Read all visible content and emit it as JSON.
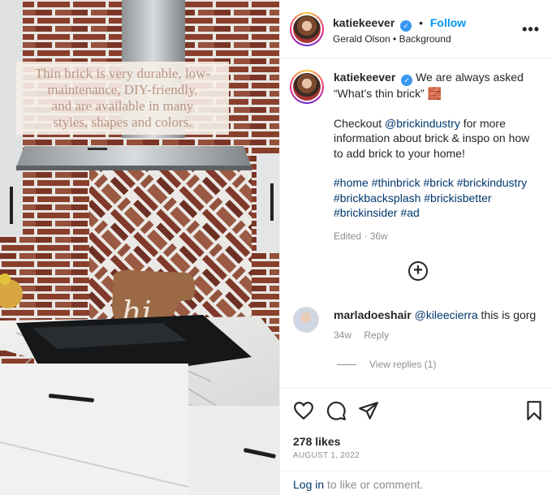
{
  "photo": {
    "caption": "Thin brick is very durable, low-\nmaintenance, DIY-friendly,\nand are available in many\nstyles, shapes and colors.",
    "sign_text": "hi"
  },
  "header": {
    "username": "katiekeever",
    "separator": "•",
    "follow_label": "Follow",
    "subline": "Gerald Olson • Background",
    "more_label": "•••"
  },
  "post": {
    "username": "katiekeever",
    "line1": "We are always asked “What’s thin brick”",
    "emoji": "🧱",
    "para2_pre": "Checkout ",
    "para2_link": "@brickindustry",
    "para2_post": " for more information about brick & inspo on how to add brick to your home!",
    "hashtags": "#home #thinbrick #brick #brickindustry #brickbacksplash #brickisbetter #brickinsider #ad",
    "edited": "Edited · 36w"
  },
  "comment": {
    "username": "marladoeshair",
    "mention": "@kileecierra",
    "text": " this is gorg",
    "age": "34w",
    "reply_label": "Reply",
    "view_replies": "View replies (1)"
  },
  "stats": {
    "likes": "278 likes",
    "date": "AUGUST 1, 2022"
  },
  "footer": {
    "login_link": "Log in",
    "login_text": " to like or comment."
  },
  "colors": {
    "link": "#00376b",
    "follow": "#0095f6",
    "muted": "#8e8e8e",
    "brick": "#8a3f2d"
  }
}
